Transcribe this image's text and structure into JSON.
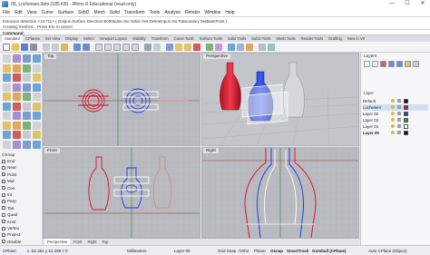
{
  "window": {
    "title": "05_Locheisen.3dm (185 KB) - Rhino 8 Educational (read-only)",
    "controls": [
      "—",
      "☐",
      "✕"
    ]
  },
  "menu": [
    "File",
    "Edit",
    "View",
    "Curve",
    "Surface",
    "SubD",
    "Mesh",
    "Solid",
    "Transform",
    "Tools",
    "Analyze",
    "Render",
    "Window",
    "Help"
  ],
  "command_history": [
    "Extrusion detection <13.711> ( Output=Surface  Direction  BothSides=No  Solid=Yes  DeleteInput=No  ToBoundary  SetBasePoint )",
    "Creating meshes... Press Esc to cancel"
  ],
  "command_prompt": "Command:",
  "toolbar_tabs": [
    "Standard",
    "CPlanes",
    "Set View",
    "Display",
    "Select",
    "Viewport Layout",
    "Visibility",
    "Transform",
    "Curve Tools",
    "Surface Tools",
    "Solid Tools",
    "SubD Tools",
    "Mesh Tools",
    "Render Tools",
    "Drafting",
    "New in V8"
  ],
  "active_toolbar_tab": "Standard",
  "viewports": {
    "top": "Top",
    "perspective": "Perspective",
    "front": "Front",
    "right": "Right"
  },
  "view_tabs": [
    "Perspective",
    "Front",
    "Right",
    "Top"
  ],
  "active_view_tab": "Perspective",
  "osnap": {
    "title": "OSnap",
    "items": [
      {
        "label": "End",
        "checked": false
      },
      {
        "label": "Near",
        "checked": false
      },
      {
        "label": "Point",
        "checked": false
      },
      {
        "label": "Mid",
        "checked": false
      },
      {
        "label": "Cen",
        "checked": false
      },
      {
        "label": "Int",
        "checked": false
      },
      {
        "label": "Perp",
        "checked": false
      },
      {
        "label": "Tan",
        "checked": false
      },
      {
        "label": "Quad",
        "checked": false
      },
      {
        "label": "Knot",
        "checked": false
      },
      {
        "label": "Vertex",
        "checked": false
      },
      {
        "label": "Project",
        "checked": false
      },
      {
        "label": "Disable",
        "checked": false
      }
    ]
  },
  "layers": {
    "title": "Layers",
    "column": "Layer",
    "rows": [
      {
        "name": "Default",
        "color": "#111111",
        "current": false,
        "bold": false
      },
      {
        "name": "Locheisen",
        "color": "#c8102e",
        "current": true,
        "bold": false
      },
      {
        "name": "Layer 02",
        "color": "#1c3fd6",
        "current": false,
        "bold": false
      },
      {
        "name": "Layer 03",
        "color": "#2a9d3a",
        "current": false,
        "bold": false
      },
      {
        "name": "Layer 04",
        "color": "#ffffff",
        "current": false,
        "bold": false
      },
      {
        "name": "Layer 05",
        "color": "#111111",
        "current": false,
        "bold": true
      }
    ]
  },
  "status": {
    "cplane": "CPlane",
    "coords": "x -62.351  y 51.288  z 0",
    "units": "Millimeters",
    "layer": "Layer 05",
    "grid_snap": "Grid Snap",
    "ortho": "Ortho",
    "planar": "Planar",
    "osnap": "Osnap",
    "smarttrack": "SmartTrack",
    "gumball": "Gumball (CPlane)",
    "record_history": "Record History",
    "filter": "Filter",
    "auto_cplane": "Auto CPlane (Object)",
    "time": "Absolute tolerance: 0.001"
  },
  "colors": {
    "red": "#d4142c",
    "blue": "#1b3ee0",
    "white": "#ffffff",
    "viewport_bg": "#b9bbc0",
    "grid": "#a5a7ac"
  }
}
